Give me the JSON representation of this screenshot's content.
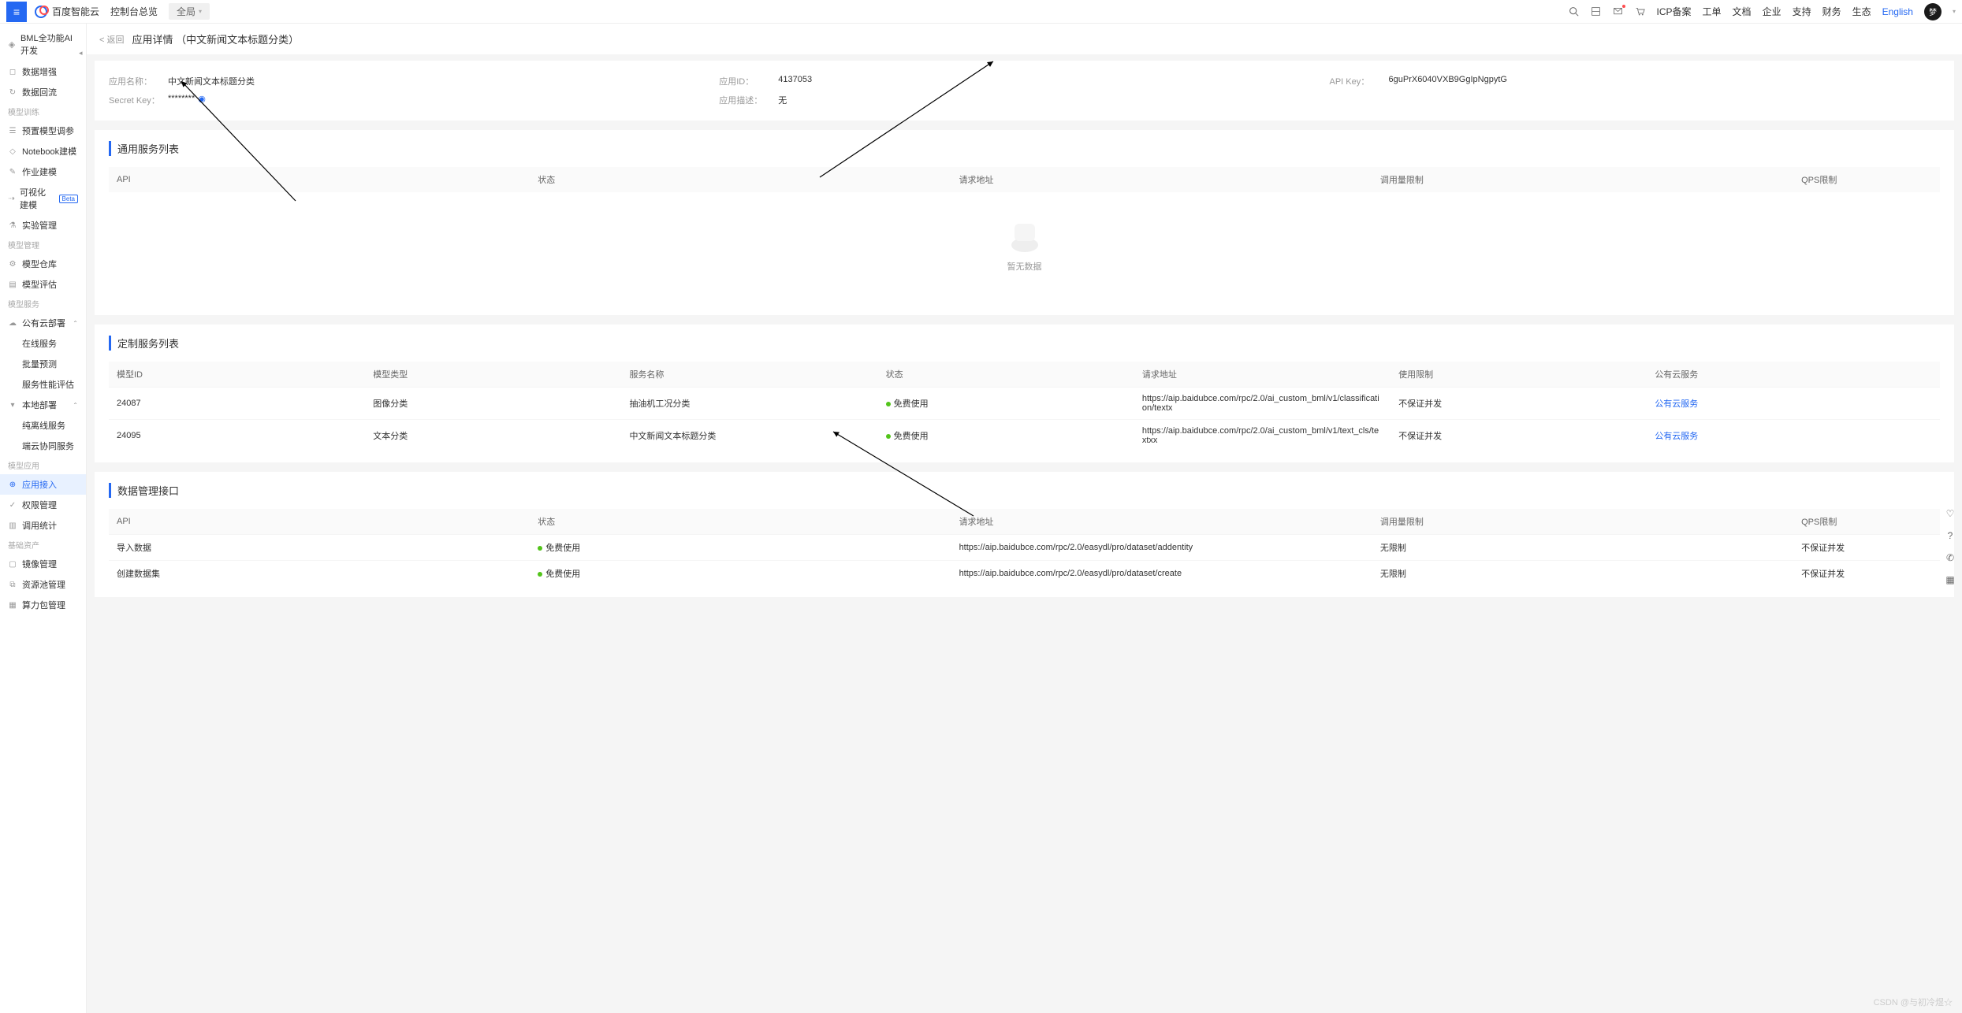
{
  "top": {
    "logo": "百度智能云",
    "breadcrumb": "控制台总览",
    "scope": "全局",
    "nav": [
      "ICP备案",
      "工单",
      "文档",
      "企业",
      "支持",
      "财务",
      "生态",
      "English"
    ],
    "avatar": "梦"
  },
  "sidebar": {
    "product": "BML全功能AI开发",
    "items": [
      {
        "t": "item",
        "label": "数据增强",
        "ic": "◻"
      },
      {
        "t": "item",
        "label": "数据回流",
        "ic": "↻"
      },
      {
        "t": "group",
        "label": "模型训练"
      },
      {
        "t": "item",
        "label": "预置模型调参",
        "ic": "☰"
      },
      {
        "t": "item",
        "label": "Notebook建模",
        "ic": "◇"
      },
      {
        "t": "item",
        "label": "作业建模",
        "ic": "✎"
      },
      {
        "t": "item",
        "label": "可视化建模",
        "ic": "⇢",
        "beta": true
      },
      {
        "t": "item",
        "label": "实验管理",
        "ic": "⚗"
      },
      {
        "t": "group",
        "label": "模型管理"
      },
      {
        "t": "item",
        "label": "模型仓库",
        "ic": "⚙"
      },
      {
        "t": "item",
        "label": "模型评估",
        "ic": "▤"
      },
      {
        "t": "group",
        "label": "模型服务"
      },
      {
        "t": "item",
        "label": "公有云部署",
        "ic": "☁",
        "arr": "up"
      },
      {
        "t": "sub",
        "label": "在线服务"
      },
      {
        "t": "sub",
        "label": "批量预测"
      },
      {
        "t": "sub",
        "label": "服务性能评估"
      },
      {
        "t": "item",
        "label": "本地部署",
        "ic": "▾",
        "arr": "up"
      },
      {
        "t": "sub",
        "label": "纯离线服务"
      },
      {
        "t": "sub",
        "label": "端云协同服务"
      },
      {
        "t": "group",
        "label": "模型应用"
      },
      {
        "t": "item",
        "label": "应用接入",
        "ic": "⊕",
        "active": true
      },
      {
        "t": "item",
        "label": "权限管理",
        "ic": "✓"
      },
      {
        "t": "item",
        "label": "调用统计",
        "ic": "▥"
      },
      {
        "t": "group",
        "label": "基础资产"
      },
      {
        "t": "item",
        "label": "镜像管理",
        "ic": "▢"
      },
      {
        "t": "item",
        "label": "资源池管理",
        "ic": "⧉"
      },
      {
        "t": "item",
        "label": "算力包管理",
        "ic": "▦"
      }
    ]
  },
  "page": {
    "back": "< 返回",
    "title": "应用详情 （中文新闻文本标题分类）"
  },
  "info": {
    "appNameL": "应用名称：",
    "appName": "中文新闻文本标题分类",
    "appIdL": "应用ID：",
    "appId": "4137053",
    "apiKeyL": "API Key：",
    "apiKey": "6guPrX6040VXB9GgIpNgpytG",
    "secretL": "Secret Key：",
    "secret": "********",
    "descL": "应用描述：",
    "desc": "无"
  },
  "s1": {
    "title": "通用服务列表",
    "cols": [
      "API",
      "状态",
      "请求地址",
      "调用量限制",
      "QPS限制"
    ],
    "empty": "暂无数据"
  },
  "s2": {
    "title": "定制服务列表",
    "cols": [
      "模型ID",
      "模型类型",
      "服务名称",
      "状态",
      "请求地址",
      "使用限制",
      "公有云服务"
    ],
    "rows": [
      {
        "id": "24087",
        "type": "图像分类",
        "name": "抽油机工况分类",
        "status": "免费使用",
        "url": "https://aip.baidubce.com/rpc/2.0/ai_custom_bml/v1/classification/textx",
        "limit": "不保证并发",
        "svc": "公有云服务"
      },
      {
        "id": "24095",
        "type": "文本分类",
        "name": "中文新闻文本标题分类",
        "status": "免费使用",
        "url": "https://aip.baidubce.com/rpc/2.0/ai_custom_bml/v1/text_cls/textxx",
        "limit": "不保证并发",
        "svc": "公有云服务"
      }
    ]
  },
  "s3": {
    "title": "数据管理接口",
    "cols": [
      "API",
      "状态",
      "请求地址",
      "调用量限制",
      "QPS限制"
    ],
    "rows": [
      {
        "api": "导入数据",
        "status": "免费使用",
        "url": "https://aip.baidubce.com/rpc/2.0/easydl/pro/dataset/addentity",
        "call": "无限制",
        "qps": "不保证并发"
      },
      {
        "api": "创建数据集",
        "status": "免费使用",
        "url": "https://aip.baidubce.com/rpc/2.0/easydl/pro/dataset/create",
        "call": "无限制",
        "qps": "不保证并发"
      }
    ]
  },
  "watermark": "CSDN @与初冷煜☆"
}
